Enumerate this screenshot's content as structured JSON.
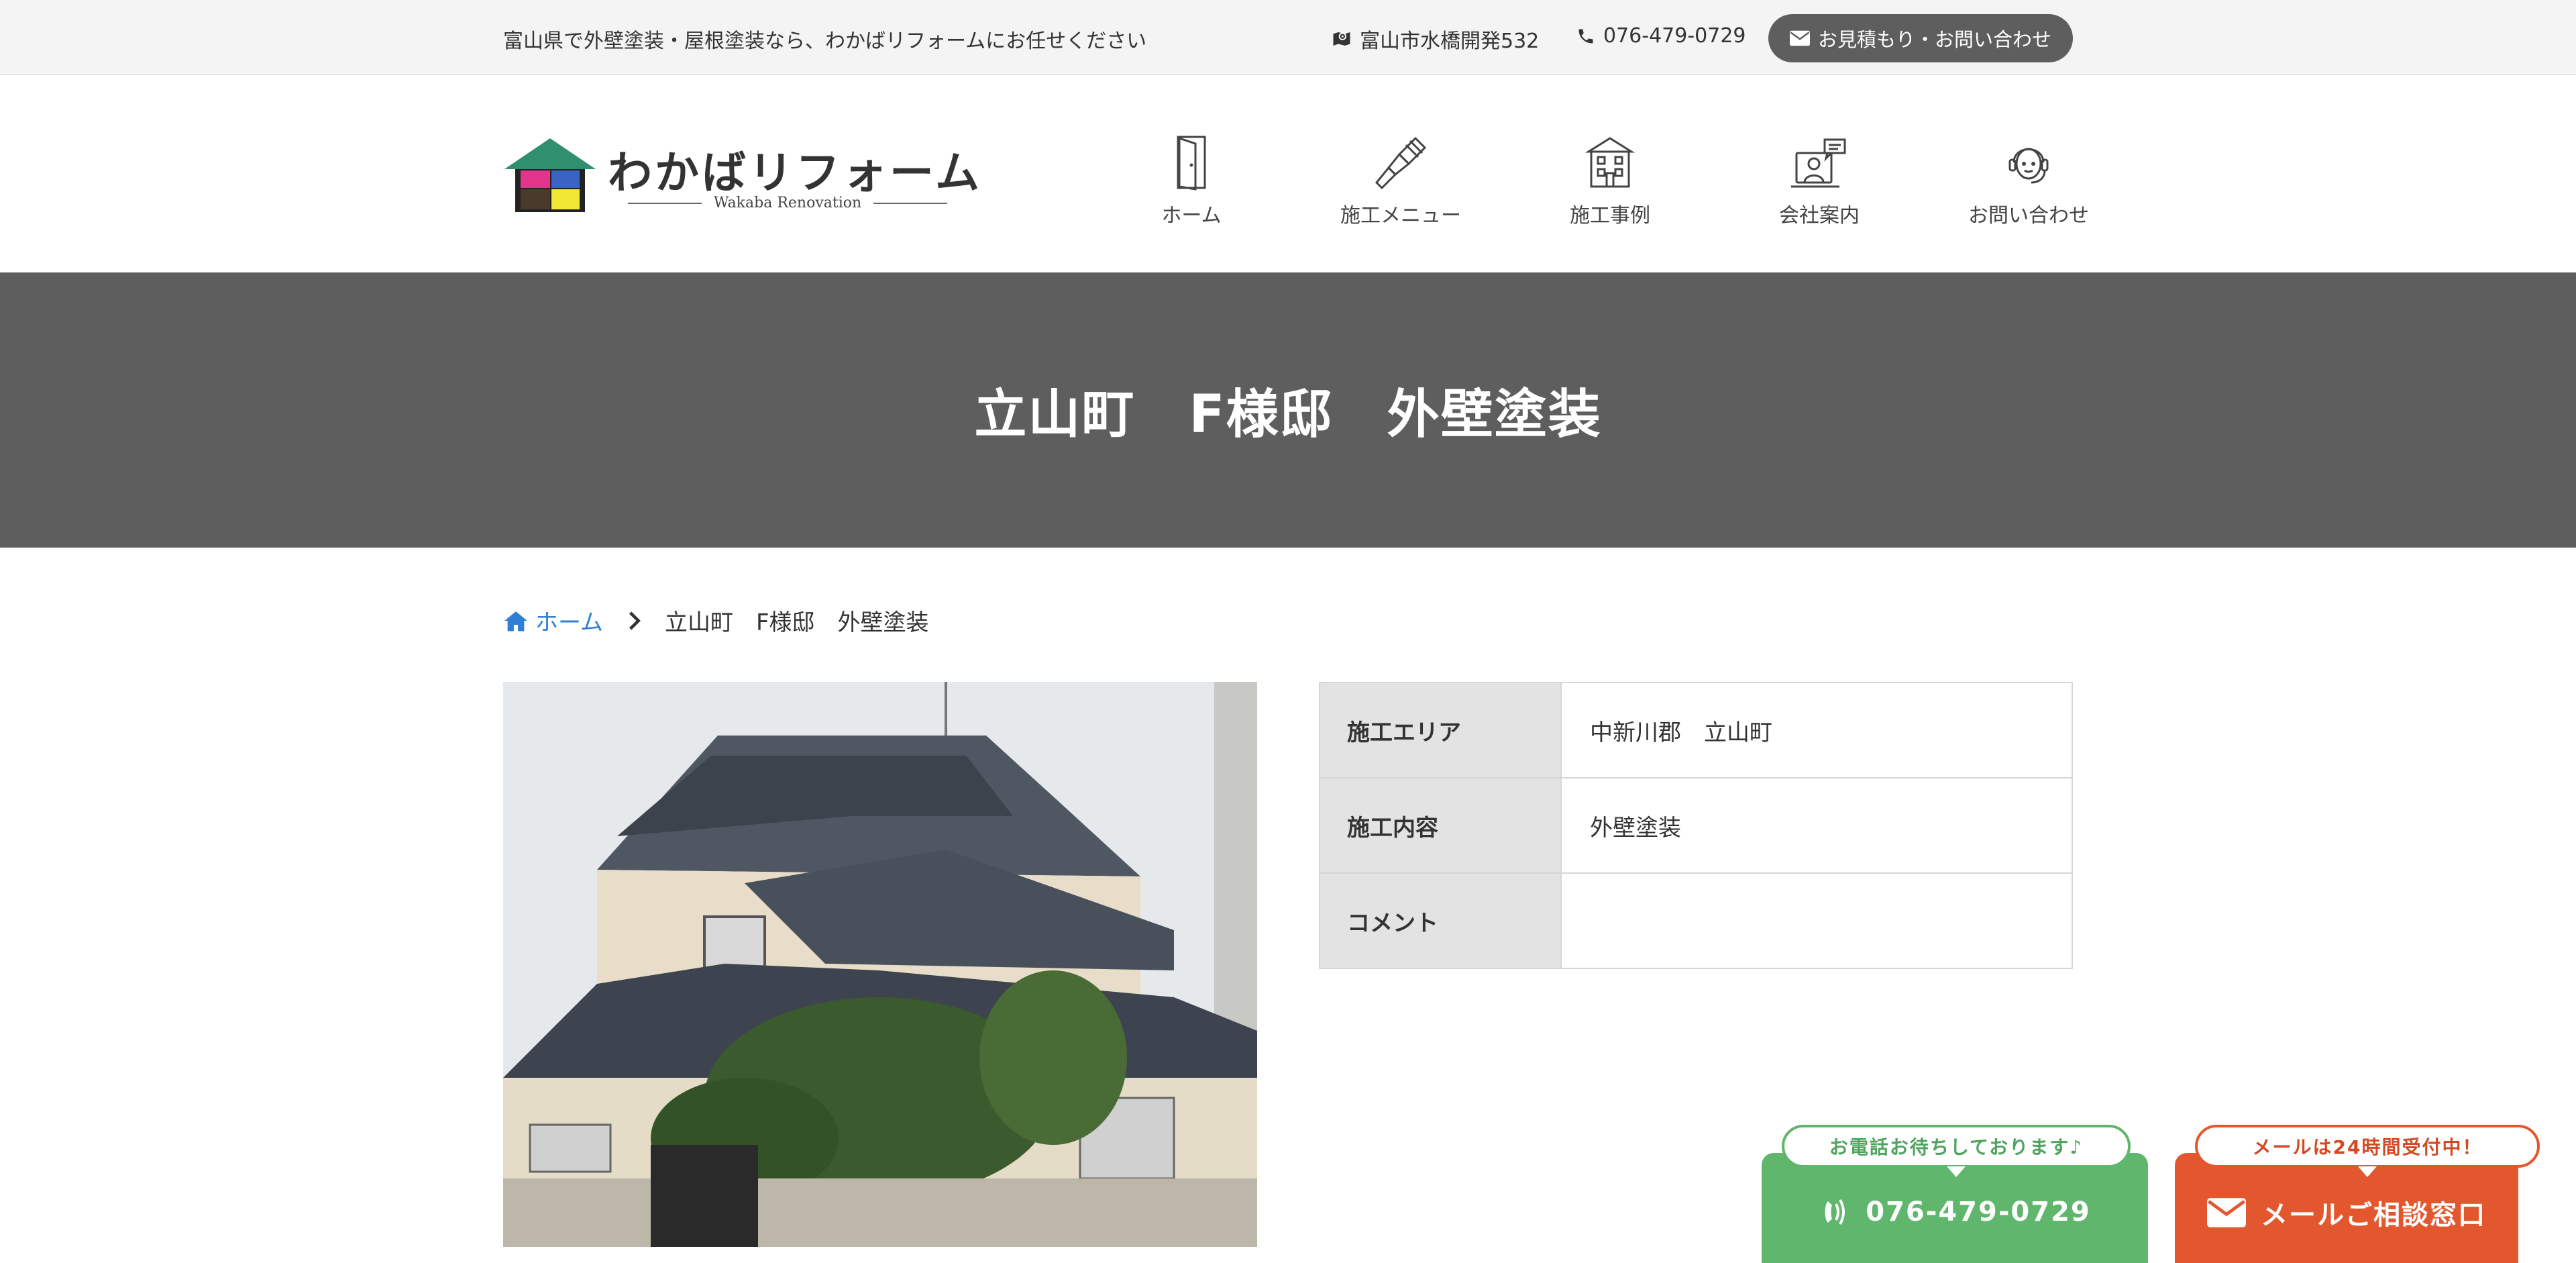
{
  "topbar": {
    "tagline": "富山県で外壁塗装・屋根塗装なら、わかばリフォームにお任せください",
    "address": "富山市水橋開発532",
    "phone": "076-479-0729",
    "contact_button": "お見積もり・お問い合わせ"
  },
  "logo": {
    "name": "わかばリフォーム",
    "subtitle": "Wakaba Renovation",
    "colors": [
      "#2f8f6f",
      "#e0358a",
      "#3a63c4",
      "#4a3a2a",
      "#f2e634"
    ]
  },
  "nav": {
    "items": [
      {
        "label": "ホーム",
        "icon": "door-icon"
      },
      {
        "label": "施工メニュー",
        "icon": "paintbrush-icon"
      },
      {
        "label": "施工事例",
        "icon": "house-icon"
      },
      {
        "label": "会社案内",
        "icon": "person-chat-icon"
      },
      {
        "label": "お問い合わせ",
        "icon": "headset-icon"
      }
    ]
  },
  "hero": {
    "title": "立山町　F様邸　外壁塗装"
  },
  "breadcrumb": {
    "home": "ホーム",
    "current": "立山町　F様邸　外壁塗装"
  },
  "info": {
    "rows": [
      {
        "key": "施工エリア",
        "value": "中新川郡　立山町"
      },
      {
        "key": "施工内容",
        "value": "外壁塗装"
      },
      {
        "key": "コメント",
        "value": ""
      }
    ]
  },
  "cta": {
    "tel_bubble": "お電話お待ちしております♪",
    "tel_number": "076-479-0729",
    "mail_bubble": "メールは24時間受付中！",
    "mail_label": "メールご相談窓口"
  },
  "colors": {
    "topbar_bg": "#f4f4f4",
    "hero_bg": "#5e5e5e",
    "link": "#2f7fd6",
    "tel_green": "#5fb66c",
    "mail_orange": "#e3572f"
  }
}
